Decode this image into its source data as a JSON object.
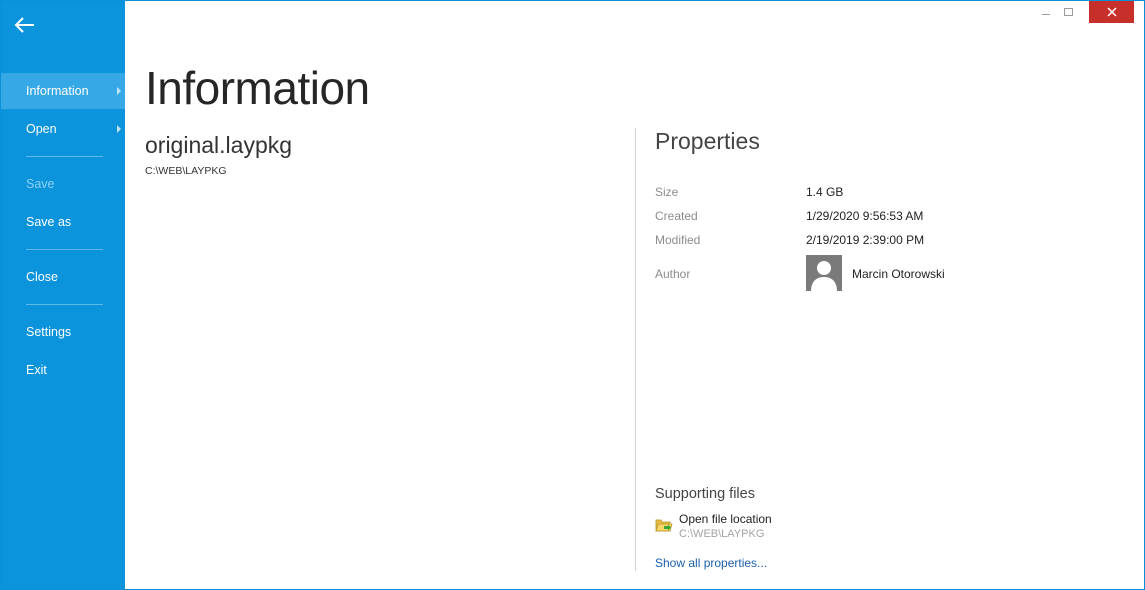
{
  "sidebar": {
    "items": [
      {
        "label": "Information"
      },
      {
        "label": "Open"
      },
      {
        "label": "Save"
      },
      {
        "label": "Save as"
      },
      {
        "label": "Close"
      },
      {
        "label": "Settings"
      },
      {
        "label": "Exit"
      }
    ]
  },
  "main": {
    "title": "Information",
    "file_name": "original.laypkg",
    "file_path": "C:\\WEB\\LAYPKG"
  },
  "properties": {
    "title": "Properties",
    "size_label": "Size",
    "size_value": "1.4 GB",
    "created_label": "Created",
    "created_value": "1/29/2020 9:56:53 AM",
    "modified_label": "Modified",
    "modified_value": "2/19/2019 2:39:00 PM",
    "author_label": "Author",
    "author_name": "Marcin Otorowski"
  },
  "supporting": {
    "title": "Supporting files",
    "open_location_label": "Open file location",
    "open_location_path": "C:\\WEB\\LAYPKG",
    "show_all_label": "Show all properties..."
  },
  "colors": {
    "sidebar_bg": "#0b93dc",
    "sidebar_active": "#36a8e6",
    "close_button": "#c7302a",
    "link": "#1b5fae"
  }
}
